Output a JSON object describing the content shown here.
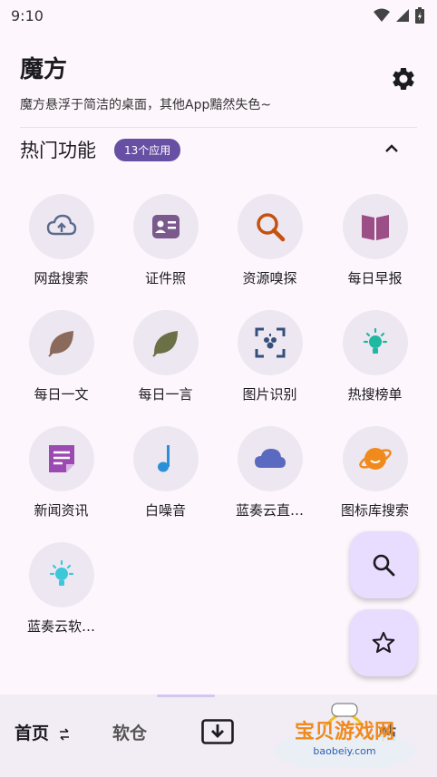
{
  "status_bar": {
    "time": "9:10"
  },
  "header": {
    "title": "魔方",
    "subtitle": "魔方悬浮于简洁的桌面，其他App黯然失色~"
  },
  "section": {
    "title": "热门功能",
    "badge": "13个应用"
  },
  "features": [
    {
      "label": "网盘搜索",
      "icon": "cloud-upload-icon",
      "color": "#5b6b8c"
    },
    {
      "label": "证件照",
      "icon": "id-card-icon",
      "color": "#7a5a8c"
    },
    {
      "label": "资源嗅探",
      "icon": "search-icon",
      "color": "#c4510f"
    },
    {
      "label": "每日早报",
      "icon": "book-icon",
      "color": "#9c4e86"
    },
    {
      "label": "每日一文",
      "icon": "leaf-icon",
      "color": "#8a6a5a"
    },
    {
      "label": "每日一言",
      "icon": "leaf-icon",
      "color": "#6b7046"
    },
    {
      "label": "图片识别",
      "icon": "scan-icon",
      "color": "#35507a"
    },
    {
      "label": "热搜榜单",
      "icon": "lightbulb-icon",
      "color": "#1fb8a0"
    },
    {
      "label": "新闻资讯",
      "icon": "note-icon",
      "color": "#9a4ab0"
    },
    {
      "label": "白噪音",
      "icon": "music-note-icon",
      "color": "#2a8fd6"
    },
    {
      "label": "蓝奏云直…",
      "icon": "cloud-icon",
      "color": "#5a6ac0"
    },
    {
      "label": "图标库搜索",
      "icon": "planet-icon",
      "color": "#f08a1c"
    },
    {
      "label": "蓝奏云软…",
      "icon": "lightbulb-icon",
      "color": "#3cc8d8"
    }
  ],
  "bottom_nav": {
    "home": "首页",
    "market": "软仓",
    "posts": "帖"
  },
  "watermark": {
    "text": "宝贝游戏网",
    "url": "baobeiy.com"
  }
}
